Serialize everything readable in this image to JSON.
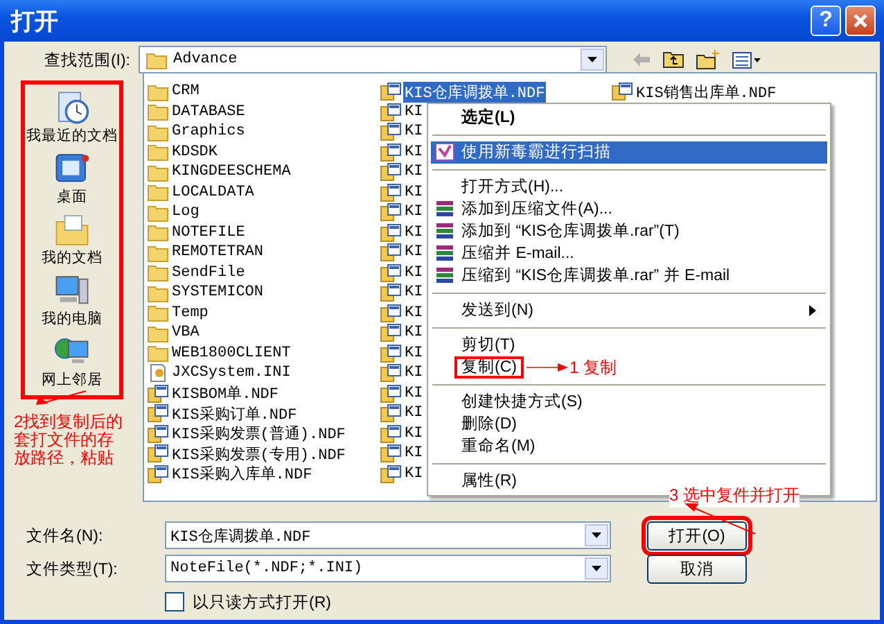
{
  "window": {
    "title": "打开"
  },
  "title_buttons": [
    {
      "kind": "help",
      "label": "?"
    },
    {
      "kind": "close"
    }
  ],
  "look_in": {
    "label": "查找范围(I):",
    "value": "Advance"
  },
  "toolbar": [
    {
      "kind": "back"
    },
    {
      "kind": "up"
    },
    {
      "kind": "new_folder"
    },
    {
      "kind": "views"
    }
  ],
  "places": {
    "boxed": true,
    "items": [
      {
        "kind": "recent",
        "label": "我最近的文档"
      },
      {
        "kind": "desktop",
        "label": "桌面"
      },
      {
        "kind": "documents",
        "label": "我的文档"
      },
      {
        "kind": "computer",
        "label": "我的电脑"
      },
      {
        "kind": "network",
        "label": "网上邻居"
      }
    ]
  },
  "files": {
    "columns": [
      [
        {
          "kind": "folder",
          "name": "CRM",
          "selected": false
        },
        {
          "kind": "folder",
          "name": "DATABASE",
          "selected": false
        },
        {
          "kind": "folder",
          "name": "Graphics",
          "selected": false
        },
        {
          "kind": "folder",
          "name": "KDSDK",
          "selected": false
        },
        {
          "kind": "folder",
          "name": "KINGDEESCHEMA",
          "selected": false
        },
        {
          "kind": "folder",
          "name": "LOCALDATA",
          "selected": false
        },
        {
          "kind": "folder",
          "name": "Log",
          "selected": false
        },
        {
          "kind": "folder",
          "name": "NOTEFILE",
          "selected": false
        },
        {
          "kind": "folder",
          "name": "REMOTETRAN",
          "selected": false
        },
        {
          "kind": "folder",
          "name": "SendFile",
          "selected": false
        },
        {
          "kind": "folder",
          "name": "SYSTEMICON",
          "selected": false
        },
        {
          "kind": "folder",
          "name": "Temp",
          "selected": false
        },
        {
          "kind": "folder",
          "name": "VBA",
          "selected": false
        },
        {
          "kind": "folder",
          "name": "WEB1800CLIENT",
          "selected": false
        },
        {
          "kind": "ini",
          "name": "JXCSystem.INI",
          "selected": false
        },
        {
          "kind": "ndf",
          "name": "KISBOM单.NDF",
          "selected": false
        },
        {
          "kind": "ndf",
          "name": "KIS采购订单.NDF",
          "selected": false
        },
        {
          "kind": "ndf",
          "name": "KIS采购发票(普通).NDF",
          "selected": false
        },
        {
          "kind": "ndf",
          "name": "KIS采购发票(专用).NDF",
          "selected": false
        },
        {
          "kind": "ndf",
          "name": "KIS采购入库单.NDF",
          "selected": false
        }
      ],
      [
        {
          "kind": "ndf",
          "name": "KIS仓库调拨单.NDF",
          "selected": true
        },
        {
          "kind": "ndf",
          "name": "KI",
          "selected": false
        },
        {
          "kind": "ndf",
          "name": "KI",
          "selected": false
        },
        {
          "kind": "ndf",
          "name": "KI",
          "selected": false
        },
        {
          "kind": "ndf",
          "name": "KI",
          "selected": false
        },
        {
          "kind": "ndf",
          "name": "KI",
          "selected": false
        },
        {
          "kind": "ndf",
          "name": "KI",
          "selected": false
        },
        {
          "kind": "ndf",
          "name": "KI",
          "selected": false
        },
        {
          "kind": "ndf",
          "name": "KI",
          "selected": false
        },
        {
          "kind": "ndf",
          "name": "KI",
          "selected": false
        },
        {
          "kind": "ndf",
          "name": "KI",
          "selected": false
        },
        {
          "kind": "ndf",
          "name": "KI",
          "selected": false
        },
        {
          "kind": "ndf",
          "name": "KI",
          "selected": false
        },
        {
          "kind": "ndf",
          "name": "KI",
          "selected": false
        },
        {
          "kind": "ndf",
          "name": "KI",
          "selected": false
        },
        {
          "kind": "ndf",
          "name": "KI",
          "selected": false
        },
        {
          "kind": "ndf",
          "name": "KI",
          "selected": false
        },
        {
          "kind": "ndf",
          "name": "KI",
          "selected": false
        },
        {
          "kind": "ndf",
          "name": "KI",
          "selected": false
        },
        {
          "kind": "ndf",
          "name": "KI",
          "selected": false
        }
      ],
      [
        {
          "kind": "ndf",
          "name": "KIS销售出库单.NDF",
          "selected": false
        }
      ]
    ]
  },
  "context_menu": [
    {
      "kind": "item",
      "label": "选定(L)",
      "bold": true,
      "selected": false
    },
    {
      "kind": "separator"
    },
    {
      "kind": "scan",
      "label": "使用新毒霸进行扫描",
      "selected": true
    },
    {
      "kind": "separator"
    },
    {
      "kind": "item",
      "label": "打开方式(H)...",
      "selected": false
    },
    {
      "kind": "archive",
      "label": "添加到压缩文件(A)...",
      "selected": false
    },
    {
      "kind": "archive",
      "label": "添加到 “KIS仓库调拨单.rar”(T)",
      "selected": false
    },
    {
      "kind": "archive",
      "label": "压缩并 E-mail...",
      "selected": false
    },
    {
      "kind": "archive",
      "label": "压缩到 “KIS仓库调拨单.rar” 并 E-mail",
      "selected": false
    },
    {
      "kind": "separator"
    },
    {
      "kind": "item",
      "label": "发送到(N)",
      "submenu": true,
      "selected": false
    },
    {
      "kind": "separator"
    },
    {
      "kind": "item",
      "label": "剪切(T)",
      "selected": false
    },
    {
      "kind": "item",
      "label": "复制(C)",
      "boxed": true,
      "note": "1 复制",
      "selected": false
    },
    {
      "kind": "separator"
    },
    {
      "kind": "item",
      "label": "创建快捷方式(S)",
      "selected": false
    },
    {
      "kind": "item",
      "label": "删除(D)",
      "selected": false
    },
    {
      "kind": "item",
      "label": "重命名(M)",
      "selected": false
    },
    {
      "kind": "separator"
    },
    {
      "kind": "item",
      "label": "属性(R)",
      "selected": false
    }
  ],
  "places_note": "2找到复制后的套打文件的存放路径，粘贴",
  "open_note": "3 选中复件并打开",
  "file_name": {
    "label": "文件名(N):",
    "value": "KIS仓库调拨单.NDF"
  },
  "file_type": {
    "label": "文件类型(T):",
    "value": "NoteFile(*.NDF;*.INI)"
  },
  "read_only": {
    "label": "以只读方式打开(R)",
    "checked": false
  },
  "buttons": [
    {
      "label": "打开(O)",
      "boxed": true
    },
    {
      "label": "取消",
      "boxed": false
    }
  ]
}
